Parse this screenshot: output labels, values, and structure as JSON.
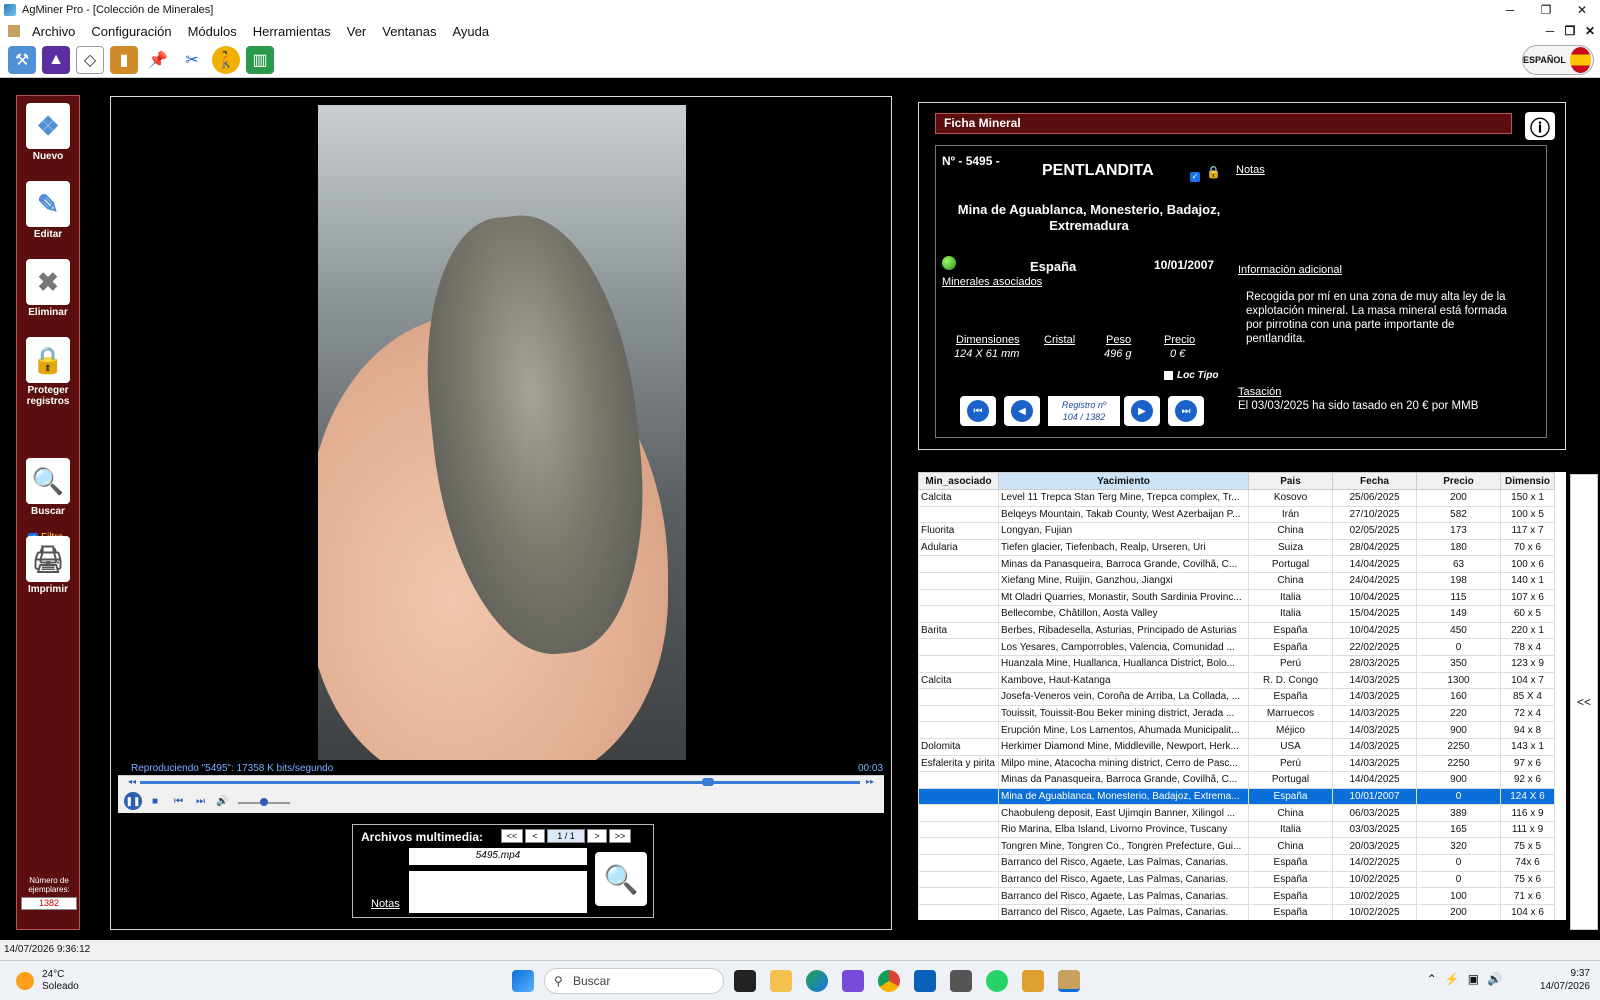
{
  "window": {
    "title": "AgMiner Pro - [Colección de Minerales]"
  },
  "menu": [
    "Archivo",
    "Configuración",
    "Módulos",
    "Herramientas",
    "Ver",
    "Ventanas",
    "Ayuda"
  ],
  "language": {
    "label": "ESPAÑOL"
  },
  "sidebar": {
    "buttons": [
      {
        "label": "Nuevo"
      },
      {
        "label": "Editar"
      },
      {
        "label": "Eliminar"
      },
      {
        "label": "Proteger registros"
      },
      {
        "label": "Buscar"
      },
      {
        "label": "Imprimir"
      }
    ],
    "filter_label": "Filtro",
    "count_label": "Número de ejemplares:",
    "count_value": "1382"
  },
  "player": {
    "status": "Reproduciendo \"5495\": 17358 K bits/segundo",
    "time": "00:03",
    "progress": 0.78,
    "volume": 0.5
  },
  "media": {
    "title": "Archivos multimedia:",
    "first": "<<",
    "prev": "<",
    "page": "1 / 1",
    "next": ">",
    "last": ">>",
    "file": "5495.mp4",
    "notes_label": "Notas"
  },
  "ficha": {
    "header": "Ficha Mineral",
    "number": "Nº - 5495 -",
    "name": "PENTLANDITA",
    "notes_link": "Notas",
    "locality": "Mina de Aguablanca, Monesterio, Badajoz, Extremadura",
    "country": "España",
    "date": "10/01/2007",
    "assoc_link": "Minerales asociados",
    "info_link": "Información adicional",
    "description": "Recogida por mí en una zona de muy alta ley de la explotación mineral. La masa mineral está formada por pirrotina con una parte importante de pentlandita.",
    "dim_label": "Dimensiones",
    "dim_value": "124 X 61 mm",
    "crystal_label": "Cristal",
    "weight_label": "Peso",
    "weight_value": "496 g",
    "price_label": "Precio",
    "price_value": "0 €",
    "loc_tipo": "Loc Tipo",
    "record_label": "Registro nº",
    "record_value": "104 / 1382",
    "tasacion_label": "Tasación",
    "tasacion_text": "El 03/03/2025 ha sido tasado en 20 € por MMB"
  },
  "grid": {
    "columns": [
      "Min_asociado",
      "Yacimiento",
      "Pais",
      "Fecha",
      "Precio",
      "Dimensio"
    ],
    "rows": [
      [
        "Calcita",
        "Level 11 Trepca Stan Terg Mine, Trepca complex, Tr...",
        "Kosovo",
        "25/06/2025",
        "200",
        "150 x 1"
      ],
      [
        "",
        "Belqeys Mountain, Takab County, West Azerbaijan P...",
        "Irán",
        "27/10/2025",
        "582",
        "100 x 5"
      ],
      [
        "Fluorita",
        "Longyan, Fujian",
        "China",
        "02/05/2025",
        "173",
        "117 x 7"
      ],
      [
        "Adularia",
        "Tiefen glacier, Tiefenbach, Realp, Urseren, Uri",
        "Suiza",
        "28/04/2025",
        "180",
        "70 x 6"
      ],
      [
        "",
        "Minas da Panasqueira, Barroca Grande, Covilhã, C...",
        "Portugal",
        "14/04/2025",
        "63",
        "100 x 6"
      ],
      [
        "",
        "Xiefang Mine, Ruijin, Ganzhou, Jiangxi",
        "China",
        "24/04/2025",
        "198",
        "140 x 1"
      ],
      [
        "",
        "Mt Oladri Quarries, Monastir, South Sardinia Provinc...",
        "Italia",
        "10/04/2025",
        "115",
        "107 x 6"
      ],
      [
        "",
        "Bellecombe, Châtillon, Aosta Valley",
        "Italia",
        "15/04/2025",
        "149",
        "60 x 5"
      ],
      [
        "Barita",
        "Berbes, Ribadesella, Asturias, Principado de Asturias",
        "España",
        "10/04/2025",
        "450",
        "220 x 1"
      ],
      [
        "",
        "Los Yesares, Camporrobles, Valencia, Comunidad ...",
        "España",
        "22/02/2025",
        "0",
        "78 x 4"
      ],
      [
        "",
        "Huanzala Mine, Huallanca, Huallanca District, Bolo...",
        "Perú",
        "28/03/2025",
        "350",
        "123 x 9"
      ],
      [
        "Calcita",
        "Kambove, Haut-Katanga",
        "R. D. Congo",
        "14/03/2025",
        "1300",
        "104 x 7"
      ],
      [
        "",
        "Josefa-Veneros vein, Coroña de Arriba, La Collada, ...",
        "España",
        "14/03/2025",
        "160",
        "85 X 4"
      ],
      [
        "",
        "Touissit, Touissit-Bou Beker mining district, Jerada ...",
        "Marruecos",
        "14/03/2025",
        "220",
        "72 x 4"
      ],
      [
        "",
        "Erupción Mine, Los Lamentos, Ahumada Municipalit...",
        "Méjico",
        "14/03/2025",
        "900",
        "94 x 8"
      ],
      [
        "Dolomita",
        "Herkimer Diamond Mine, Middleville, Newport, Herk...",
        "USA",
        "14/03/2025",
        "2250",
        "143 x 1"
      ],
      [
        "Esfalerita y pirita",
        "Milpo mine, Atacocha mining district, Cerro de Pasc...",
        "Perú",
        "14/03/2025",
        "2250",
        "97 x 6"
      ],
      [
        "",
        "Minas da Panasqueira, Barroca Grande, Covilhã, C...",
        "Portugal",
        "14/04/2025",
        "900",
        "92 x 6"
      ],
      [
        "",
        "Mina de Aguablanca, Monesterio, Badajoz, Extrema...",
        "España",
        "10/01/2007",
        "0",
        "124 X 6"
      ],
      [
        "",
        "Chaobuleng deposit, East Ujimqin Banner, Xilingol ...",
        "China",
        "06/03/2025",
        "389",
        "116 x 9"
      ],
      [
        "",
        "Rio Marina, Elba Island, Livorno Province, Tuscany",
        "Italia",
        "03/03/2025",
        "165",
        "111 x 9"
      ],
      [
        "",
        "Tongren Mine, Tongren Co., Tongren Prefecture, Gui...",
        "China",
        "20/03/2025",
        "320",
        "75 x 5"
      ],
      [
        "",
        "Barranco del Risco, Agaete, Las Palmas, Canarias.",
        "España",
        "14/02/2025",
        "0",
        "74x 6"
      ],
      [
        "",
        "Barranco del Risco, Agaete, Las Palmas, Canarias.",
        "España",
        "10/02/2025",
        "0",
        "75 x 6"
      ],
      [
        "",
        "Barranco del Risco, Agaete, Las Palmas, Canarias.",
        "España",
        "10/02/2025",
        "100",
        "71 x 6"
      ],
      [
        "",
        "Barranco del Risco, Agaete, Las Palmas, Canarias.",
        "España",
        "10/02/2025",
        "200",
        "104 x 6"
      ]
    ],
    "selected_row": 18,
    "collapse_label": "<<"
  },
  "statusbar": {
    "text": "14/07/2026 9:36:12"
  },
  "taskbar": {
    "temp": "24°C",
    "weather": "Soleado",
    "search": "Buscar",
    "time": "9:37",
    "date": "14/07/2026"
  }
}
